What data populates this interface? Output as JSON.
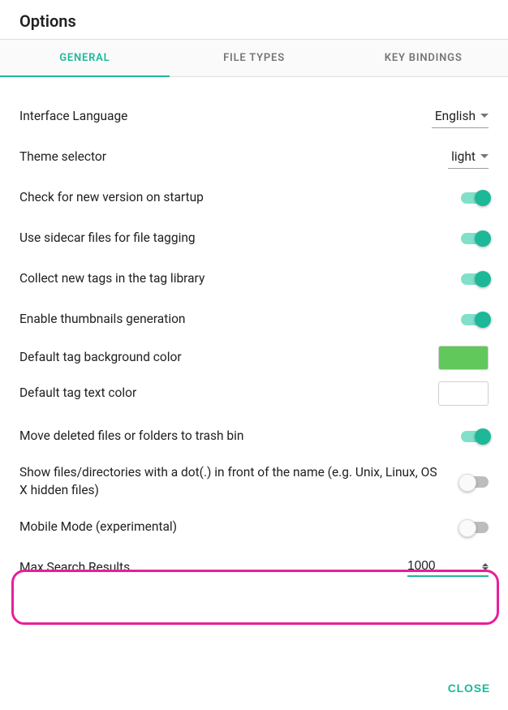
{
  "title": "Options",
  "tabs": {
    "general": "GENERAL",
    "fileTypes": "FILE TYPES",
    "keyBindings": "KEY BINDINGS"
  },
  "settings": {
    "interfaceLanguage": {
      "label": "Interface Language",
      "value": "English"
    },
    "themeSelector": {
      "label": "Theme selector",
      "value": "light"
    },
    "checkVersion": {
      "label": "Check for new version on startup",
      "on": true
    },
    "sidecar": {
      "label": "Use sidecar files for file tagging",
      "on": true
    },
    "collectTags": {
      "label": "Collect new tags in the tag library",
      "on": true
    },
    "thumbnails": {
      "label": "Enable thumbnails generation",
      "on": true
    },
    "tagBgColor": {
      "label": "Default tag background color",
      "value": "#61c85b"
    },
    "tagTextColor": {
      "label": "Default tag text color",
      "value": "#ffffff"
    },
    "trash": {
      "label": "Move deleted files or folders to trash bin",
      "on": true
    },
    "showHidden": {
      "label": "Show files/directories with a dot(.) in front of the name (e.g. Unix, Linux, OS X hidden files)",
      "on": false
    },
    "mobileMode": {
      "label": "Mobile Mode (experimental)",
      "on": false
    },
    "maxSearch": {
      "label": "Max Search Results",
      "value": "1000"
    }
  },
  "footer": {
    "close": "CLOSE"
  },
  "colors": {
    "accent": "#1db898",
    "highlight": "#e91e9c"
  }
}
